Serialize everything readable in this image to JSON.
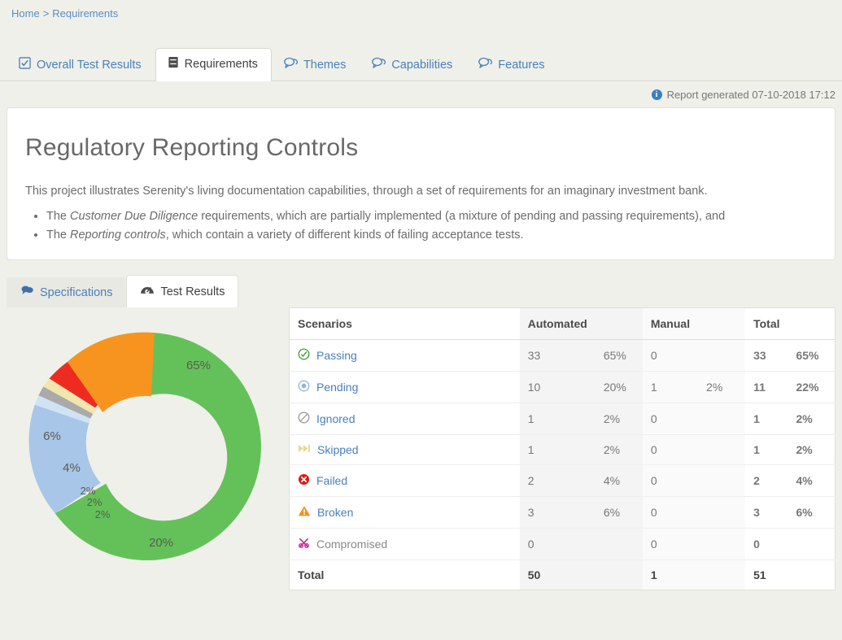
{
  "breadcrumb": {
    "home": "Home",
    "separator": ">",
    "current": "Requirements"
  },
  "main_tabs": [
    {
      "label": "Overall Test Results",
      "icon": "checkbox-icon",
      "active": false
    },
    {
      "label": "Requirements",
      "icon": "book-icon",
      "active": true
    },
    {
      "label": "Themes",
      "icon": "comments-icon",
      "active": false
    },
    {
      "label": "Capabilities",
      "icon": "comments-icon",
      "active": false
    },
    {
      "label": "Features",
      "icon": "comments-icon",
      "active": false
    }
  ],
  "report_generated": "Report generated 07-10-2018 17:12",
  "hero": {
    "title": "Regulatory Reporting Controls",
    "intro": "This project illustrates Serenity's living documentation capabilities, through a set of requirements for an imaginary investment bank.",
    "bullets": [
      {
        "pre": "The ",
        "em": "Customer Due Diligence",
        "post": " requirements, which are partially implemented (a mixture of pending and passing requirements), and"
      },
      {
        "pre": "The ",
        "em": "Reporting controls",
        "post": ", which contain a variety of different kinds of failing acceptance tests."
      }
    ]
  },
  "sub_tabs": [
    {
      "label": "Specifications",
      "icon": "comments-icon",
      "active": false
    },
    {
      "label": "Test Results",
      "icon": "speedometer-icon",
      "active": true
    }
  ],
  "table": {
    "headers": [
      "Scenarios",
      "Automated",
      "Manual",
      "Total"
    ],
    "rows": [
      {
        "label": "Passing",
        "icon": "check-circle-icon",
        "link": true,
        "auto_n": "33",
        "auto_p": "65%",
        "man_n": "0",
        "man_p": "",
        "tot_n": "33",
        "tot_p": "65%"
      },
      {
        "label": "Pending",
        "icon": "radio-circle-icon",
        "link": true,
        "auto_n": "10",
        "auto_p": "20%",
        "man_n": "1",
        "man_p": "2%",
        "tot_n": "11",
        "tot_p": "22%"
      },
      {
        "label": "Ignored",
        "icon": "ban-icon",
        "link": true,
        "auto_n": "1",
        "auto_p": "2%",
        "man_n": "0",
        "man_p": "",
        "tot_n": "1",
        "tot_p": "2%"
      },
      {
        "label": "Skipped",
        "icon": "fast-forward-icon",
        "link": true,
        "auto_n": "1",
        "auto_p": "2%",
        "man_n": "0",
        "man_p": "",
        "tot_n": "1",
        "tot_p": "2%"
      },
      {
        "label": "Failed",
        "icon": "x-circle-icon",
        "link": true,
        "auto_n": "2",
        "auto_p": "4%",
        "man_n": "0",
        "man_p": "",
        "tot_n": "2",
        "tot_p": "4%"
      },
      {
        "label": "Broken",
        "icon": "warning-triangle-icon",
        "link": true,
        "auto_n": "3",
        "auto_p": "6%",
        "man_n": "0",
        "man_p": "",
        "tot_n": "3",
        "tot_p": "6%"
      },
      {
        "label": "Compromised",
        "icon": "compromised-icon",
        "link": false,
        "auto_n": "0",
        "auto_p": "",
        "man_n": "0",
        "man_p": "",
        "tot_n": "0",
        "tot_p": ""
      }
    ],
    "total_row": {
      "label": "Total",
      "auto_n": "50",
      "auto_p": "",
      "man_n": "1",
      "man_p": "",
      "tot_n": "51",
      "tot_p": ""
    }
  },
  "chart_data": {
    "type": "pie",
    "title": "",
    "donut": true,
    "labels": [
      "Passing",
      "Pending (automated)",
      "Pending (manual)",
      "Ignored",
      "Skipped",
      "Failed",
      "Broken"
    ],
    "values": [
      65,
      20,
      2,
      2,
      2,
      4,
      6
    ],
    "display_labels": [
      "65%",
      "20%",
      "2%",
      "2%",
      "2%",
      "4%",
      "6%"
    ],
    "colors": [
      "#64c15a",
      "#a8c6e8",
      "#cfe3f5",
      "#aaaaaa",
      "#f2e6ac",
      "#ee2b20",
      "#f79420"
    ],
    "legend": "none",
    "units": "percent"
  },
  "colors": {
    "page_bg": "#eff0e9",
    "link": "#4a7fbb",
    "passing": "#64c15a",
    "pending": "#a8c6e8",
    "manual_pending": "#cfe3f5",
    "ignored": "#aaaaaa",
    "skipped": "#f2e6ac",
    "failed": "#ee2b20",
    "broken": "#f79420",
    "compromised": "#c2218e"
  }
}
